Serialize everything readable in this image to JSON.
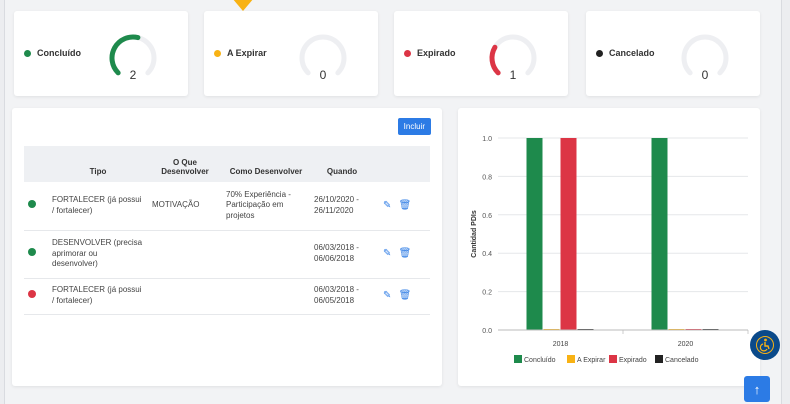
{
  "status_cards": [
    {
      "label": "Concluído",
      "value": "2",
      "color": "#1e8a4c",
      "fraction": 0.55
    },
    {
      "label": "A Expirar",
      "value": "0",
      "color": "#f8b214",
      "fraction": 0
    },
    {
      "label": "Expirado",
      "value": "1",
      "color": "#dc3545",
      "fraction": 0.28
    },
    {
      "label": "Cancelado",
      "value": "0",
      "color": "#222222",
      "fraction": 0
    }
  ],
  "table": {
    "add_button": "Incluir",
    "headers": [
      "Tipo",
      "O Que Desenvolver",
      "Como Desenvolver",
      "Quando"
    ],
    "rows": [
      {
        "status_color": "#1e8a4c",
        "tipo": "FORTALECER (já possui / fortalecer)",
        "o_que": "MOTIVAÇÃO",
        "como": "70% Experiência - Participação em projetos",
        "quando": "26/10/2020 - 26/11/2020"
      },
      {
        "status_color": "#1e8a4c",
        "tipo": "DESENVOLVER (precisa aprimorar ou desenvolver)",
        "o_que": "",
        "como": "",
        "quando": "06/03/2018 - 06/06/2018"
      },
      {
        "status_color": "#dc3545",
        "tipo": "FORTALECER (já possui / fortalecer)",
        "o_que": "",
        "como": "",
        "quando": "06/03/2018 - 06/05/2018"
      }
    ]
  },
  "chart_data": {
    "type": "bar",
    "ylabel": "Cantidad PDIs",
    "categories": [
      "2018",
      "2020"
    ],
    "ylim": [
      0,
      1.0
    ],
    "yticks": [
      "0.0",
      "0.2",
      "0.4",
      "0.6",
      "0.8",
      "1.0"
    ],
    "grid": true,
    "legend_position": "bottom",
    "series": [
      {
        "name": "Concluído",
        "color": "#1e8a4c",
        "values": [
          1,
          1
        ]
      },
      {
        "name": "A Expirar",
        "color": "#f8b214",
        "values": [
          0,
          0
        ]
      },
      {
        "name": "Expirado",
        "color": "#dc3545",
        "values": [
          1,
          0
        ]
      },
      {
        "name": "Cancelado",
        "color": "#222222",
        "values": [
          0,
          0
        ]
      }
    ]
  }
}
